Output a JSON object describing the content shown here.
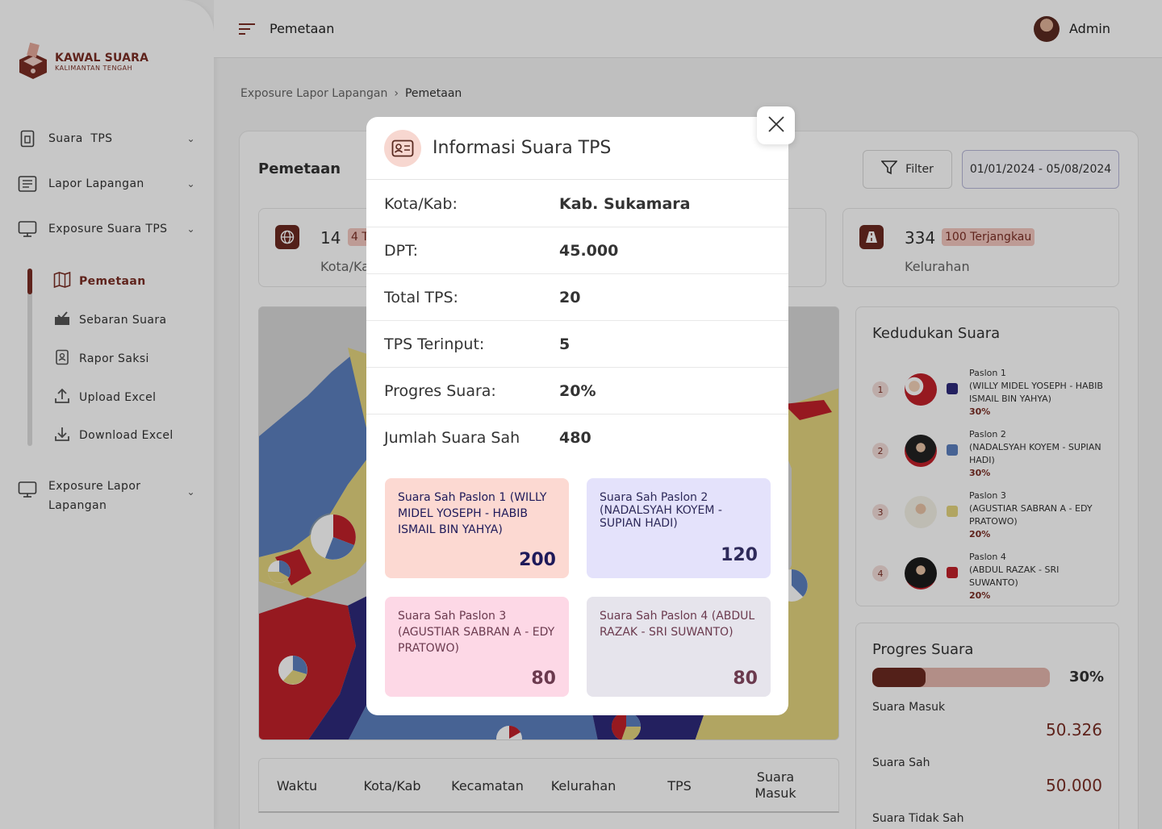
{
  "brand": {
    "name": "KAWAL SUARA",
    "sub": "KALIMANTAN TENGAH"
  },
  "sidebar": {
    "items": [
      {
        "label": "Suara  TPS"
      },
      {
        "label": "Lapor Lapangan"
      },
      {
        "label": "Exposure Suara TPS"
      },
      {
        "label": "Exposure Lapor",
        "label2": "Lapangan"
      }
    ],
    "subitems": [
      {
        "label": "Pemetaan"
      },
      {
        "label": "Sebaran Suara"
      },
      {
        "label": "Rapor Saksi"
      },
      {
        "label": "Upload Excel"
      },
      {
        "label": "Download Excel"
      }
    ]
  },
  "topbar": {
    "title": "Pemetaan",
    "user": "Admin"
  },
  "breadcrumb": {
    "parent": "Exposure Lapor Lapangan",
    "current": "Pemetaan"
  },
  "main": {
    "title": "Pemetaan",
    "filter_label": "Filter",
    "date_range": "01/01/2024 - 05/08/2024",
    "stats": [
      {
        "value": "14",
        "badge": "4 T",
        "label": "Kota/Ka"
      },
      {
        "value": "334",
        "badge": "100 Terjangkau",
        "label": "Kelurahan"
      }
    ]
  },
  "kedudukan": {
    "title": "Kedudukan Suara",
    "paslon": [
      {
        "rank": "1",
        "name": "Paslon 1",
        "detail": "(WILLY MIDEL YOSEPH - HABIB ISMAIL BIN YAHYA)",
        "pct": "30%",
        "color": "#2e2a7a"
      },
      {
        "rank": "2",
        "name": "Paslon 2",
        "detail": "(NADALSYAH KOYEM - SUPIAN HADI)",
        "pct": "30%",
        "color": "#5b7fbe"
      },
      {
        "rank": "3",
        "name": "Paslon 3",
        "detail": "(AGUSTIAR SABRAN A - EDY PRATOWO)",
        "pct": "20%",
        "color": "#e3d47e"
      },
      {
        "rank": "4",
        "name": "Paslon 4",
        "detail": "(ABDUL RAZAK - SRI SUWANTO)",
        "pct": "20%",
        "color": "#c0202a"
      }
    ]
  },
  "progres": {
    "title": "Progres Suara",
    "pct_label": "30%",
    "fill": 0.3,
    "rows": [
      {
        "label": "Suara Masuk",
        "value": "50.326"
      },
      {
        "label": "Suara Sah",
        "value": "50.000"
      },
      {
        "label": "Suara Tidak Sah",
        "value": ""
      }
    ]
  },
  "table": {
    "headers": [
      "Waktu",
      "Kota/Kab",
      "Kecamatan",
      "Kelurahan",
      "TPS",
      "Suara Masuk"
    ]
  },
  "modal": {
    "title": "Informasi Suara TPS",
    "rows": [
      {
        "label": "Kota/Kab:",
        "value": "Kab. Sukamara"
      },
      {
        "label": "DPT:",
        "value": "45.000"
      },
      {
        "label": "Total TPS:",
        "value": "20"
      },
      {
        "label": "TPS Terinput:",
        "value": "5"
      },
      {
        "label": "Progres Suara:",
        "value": "20%"
      },
      {
        "label": "Jumlah Suara Sah",
        "value": "480"
      }
    ],
    "cards": [
      {
        "title": "Suara Sah Paslon 1 (WILLY MIDEL YOSEPH - HABIB ISMAIL BIN YAHYA)",
        "value": "200",
        "bg": "#fcd9d2",
        "fg": "#1e1a5a"
      },
      {
        "title": "Suara Sah Paslon 2 (NADALSYAH KOYEM - SUPIAN HADI)",
        "value": "120",
        "bg": "#e4e2fb",
        "fg": "#2e2a5a"
      },
      {
        "title": "Suara Sah Paslon 3 (AGUSTIAR SABRAN A - EDY PRATOWO)",
        "value": "80",
        "bg": "#fdd8e6",
        "fg": "#6b3a4e"
      },
      {
        "title": "Suara Sah Paslon 4 (ABDUL RAZAK - SRI SUWANTO)",
        "value": "80",
        "bg": "#e6e4ec",
        "fg": "#6b3a4e"
      }
    ]
  }
}
